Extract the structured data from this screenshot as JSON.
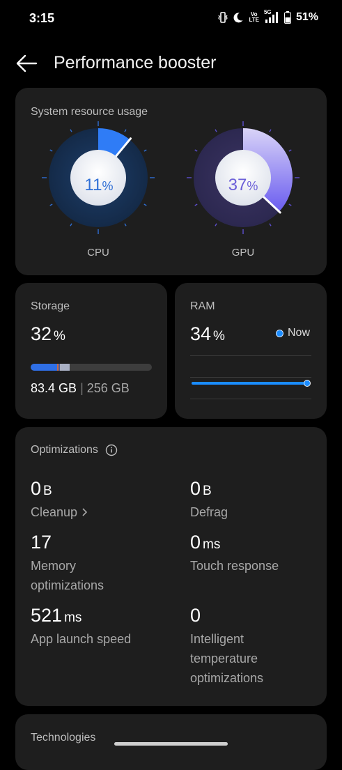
{
  "status_bar": {
    "time": "3:15",
    "volte_top": "Vo",
    "volte_bottom": "LTE",
    "network": "5G",
    "battery": "51%"
  },
  "header": {
    "title": "Performance booster",
    "back_icon": "arrow-left-icon"
  },
  "system_resource": {
    "label": "System resource usage",
    "cpu": {
      "value": "11",
      "unit": "%",
      "label": "CPU",
      "fraction": 0.11
    },
    "gpu": {
      "value": "37",
      "unit": "%",
      "label": "GPU",
      "fraction": 0.37
    }
  },
  "storage": {
    "label": "Storage",
    "value": "32",
    "unit": "%",
    "used": "83.4 GB",
    "separator": "|",
    "total": "256 GB",
    "fraction": 0.32
  },
  "ram": {
    "label": "RAM",
    "value": "34",
    "unit": "%",
    "legend": "Now"
  },
  "optimizations": {
    "label": "Optimizations",
    "info_icon": "info-icon",
    "cleanup": {
      "value": "0",
      "unit": "B",
      "label": "Cleanup"
    },
    "defrag": {
      "value": "0",
      "unit": "B",
      "label": "Defrag"
    },
    "memory": {
      "value": "17",
      "label_line1": "Memory",
      "label_line2": "optimizations"
    },
    "touch": {
      "value": "0",
      "unit": "ms",
      "label": "Touch response"
    },
    "app_launch": {
      "value": "521",
      "unit": "ms",
      "label": "App launch speed"
    },
    "temperature": {
      "value": "0",
      "label_line1": "Intelligent",
      "label_line2": "temperature",
      "label_line3": "optimizations"
    }
  },
  "technologies": {
    "label": "Technologies"
  },
  "colors": {
    "background": "#000000",
    "card": "#1e1e1e",
    "cpu_accent": "#2f7cf6",
    "gpu_accent": "#7a6cf0",
    "ram_line": "#1a8cff"
  }
}
